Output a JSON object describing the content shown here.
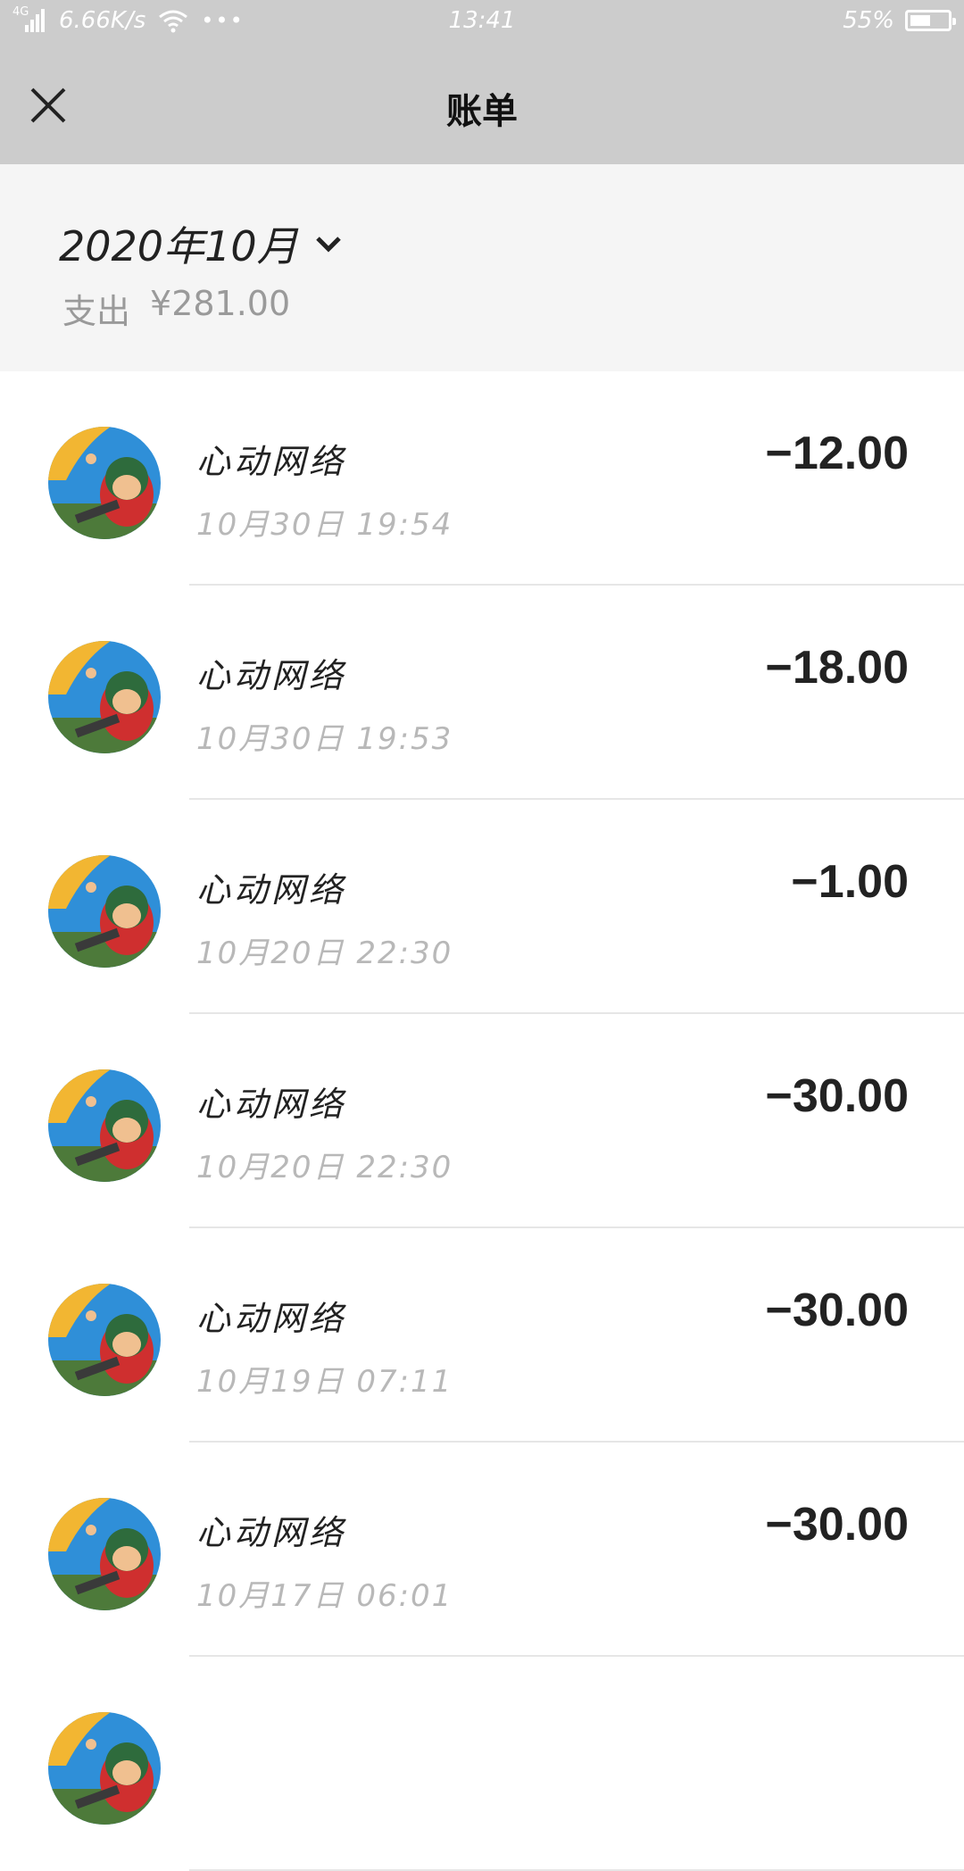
{
  "status_bar": {
    "network": "4G",
    "speed": "6.66K/s",
    "dots": "•••",
    "time": "13:41",
    "battery_text": "55%",
    "battery_level": 0.55
  },
  "navbar": {
    "title": "账单",
    "close_icon": "close-icon"
  },
  "summary": {
    "month": "2020年10月",
    "spending_label": "支出",
    "spending_amount": "¥281.00"
  },
  "transactions": [
    {
      "merchant": "心动网络",
      "datetime": "10月30日 19:54",
      "amount": "−12.00"
    },
    {
      "merchant": "心动网络",
      "datetime": "10月30日 19:53",
      "amount": "−18.00"
    },
    {
      "merchant": "心动网络",
      "datetime": "10月20日 22:30",
      "amount": "−1.00"
    },
    {
      "merchant": "心动网络",
      "datetime": "10月20日 22:30",
      "amount": "−30.00"
    },
    {
      "merchant": "心动网络",
      "datetime": "10月19日 07:11",
      "amount": "−30.00"
    },
    {
      "merchant": "心动网络",
      "datetime": "10月17日 06:01",
      "amount": "−30.00"
    },
    {
      "merchant": "",
      "datetime": "",
      "amount": ""
    }
  ],
  "colors": {
    "header_bg": "#cccccc",
    "summary_bg": "#f5f5f5",
    "text_primary": "#222222",
    "text_secondary": "#b8b8b8"
  }
}
